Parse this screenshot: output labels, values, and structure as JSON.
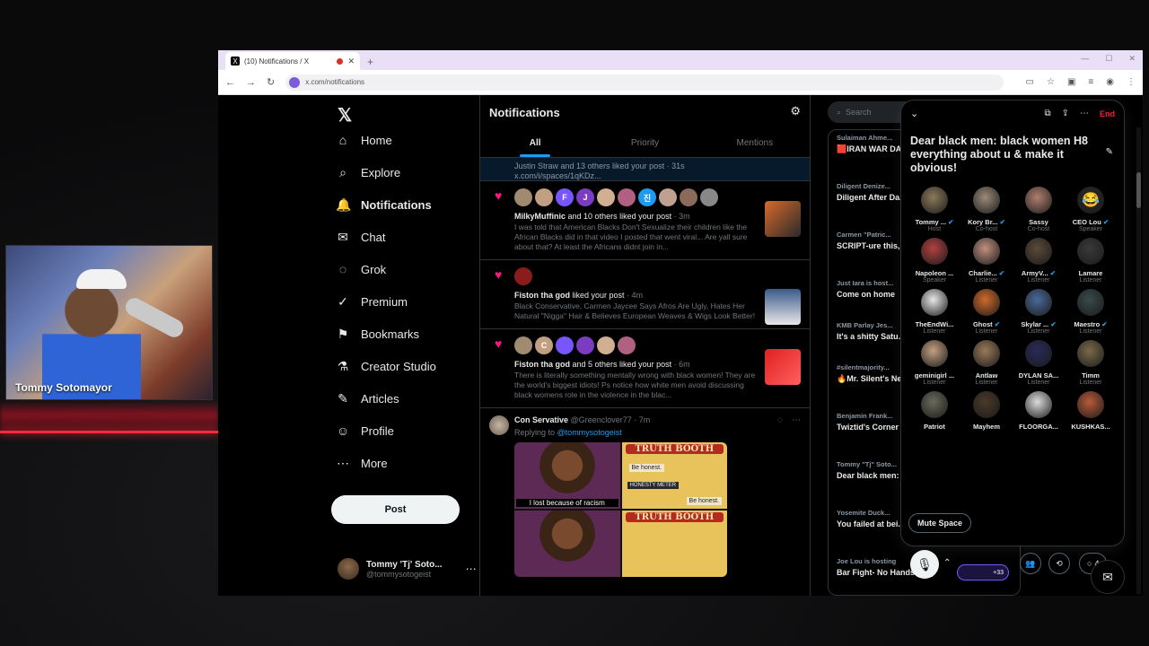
{
  "webcam": {
    "name_tag": "Tommy Sotomayor"
  },
  "browser": {
    "tab_title": "(10) Notifications / X",
    "url": "x.com/notifications"
  },
  "nav": {
    "items": [
      {
        "label": "Home",
        "icon": "home-icon",
        "glyph": "⌂"
      },
      {
        "label": "Explore",
        "icon": "search-icon",
        "glyph": "⌕"
      },
      {
        "label": "Notifications",
        "icon": "bell-icon",
        "glyph": "🔔"
      },
      {
        "label": "Chat",
        "icon": "mail-icon",
        "glyph": "✉"
      },
      {
        "label": "Grok",
        "icon": "grok-icon",
        "glyph": "◌"
      },
      {
        "label": "Premium",
        "icon": "verified-icon",
        "glyph": "✓"
      },
      {
        "label": "Bookmarks",
        "icon": "bookmark-icon",
        "glyph": "⚑"
      },
      {
        "label": "Creator Studio",
        "icon": "flask-icon",
        "glyph": "⚗"
      },
      {
        "label": "Articles",
        "icon": "article-icon",
        "glyph": "✎"
      },
      {
        "label": "Profile",
        "icon": "person-icon",
        "glyph": "☺"
      },
      {
        "label": "More",
        "icon": "more-circle-icon",
        "glyph": "⋯"
      }
    ],
    "post_label": "Post",
    "account": {
      "name": "Tommy 'Tj' Soto...",
      "handle": "@tommysotogeist"
    }
  },
  "feed": {
    "title": "Notifications",
    "tabs": [
      "All",
      "Priority",
      "Mentions"
    ],
    "strip": {
      "line1": "Justin Straw and 13 others liked your post · 31s",
      "line2": "x.com/i/spaces/1qKDz..."
    },
    "items": [
      {
        "who": "MilkyMuffinic",
        "rest": "and 10 others liked your post",
        "time": "· 3m",
        "body": "I was told that American Blacks Don't Sexualize their children like the African Blacks did in that video I posted that went viral... Are yall sure about that? At least the Africans didnt join in...",
        "avatars": [
          "",
          "",
          "F",
          "J",
          "",
          "",
          "진",
          "",
          "",
          ""
        ]
      },
      {
        "who": "Fiston tha god",
        "rest": "liked your post",
        "time": "· 4m",
        "body": "Black Conservative, Carmen Jaycee Says Afros Are Ugly, Hates Her Natural \"Nigga\" Hair & Believes European Weaves & Wigs Look Better!",
        "avatars": [
          ""
        ]
      },
      {
        "who": "Fiston tha god",
        "rest": "and 5 others liked your post",
        "time": "· 6m",
        "body": "There is literally something mentally wrong with black women! They are the world's biggest idiots! Ps notice how white men avoid discussing black womens role in the violence in the blac...",
        "avatars": [
          "",
          "C",
          "",
          "",
          "",
          ""
        ]
      }
    ],
    "reply": {
      "name": "Con Servative",
      "handle": "@Greenclover77",
      "time": "· 7m",
      "replying_to": "Replying to",
      "mention": "@tommysotogeist",
      "meme": {
        "caption": "I lost because of racism",
        "booth": "TRUTH BOOTH",
        "sign1": "Be honest.",
        "sign2": "Be honest.",
        "meter": "HONESTY METER"
      }
    }
  },
  "right": {
    "search_placeholder": "Search",
    "live": [
      {
        "host": "Sulaiman Ahme...",
        "title": "🟥IRAN WAR DA... Ryan Dawson"
      },
      {
        "host": "Diligent Denize...",
        "title": "Diligent After Da... Come Complain"
      },
      {
        "host": "Carmen \"Patric...",
        "title": "SCRIPT-ure this, ure that:✨CHOS..."
      },
      {
        "host": "Just Iara is host...",
        "title": "Come on home"
      },
      {
        "host": "KMB Parlay Jes...",
        "title": "It's a shitty Satu..."
      },
      {
        "host": "#silentmajority...",
        "title": "🔥Mr. Silent's Neighborhood🔥"
      },
      {
        "host": "Benjamin Frank...",
        "title": "Twiztid's Corner Well...Well...Well..."
      },
      {
        "host": "Tommy \"Tj\" Soto...",
        "title": "Dear black men: women H8 every..."
      },
      {
        "host": "Yosemite Duck...",
        "title": "You failed at bei... twitter space host?"
      },
      {
        "host": "Joe Lou is hosting",
        "title": "Bar Fight- No Hands Only"
      }
    ],
    "pill_count": "+33"
  },
  "space": {
    "end_label": "End",
    "title": "Dear black men: black women H8 everything about u & make it obvious!",
    "participants": [
      {
        "name": "Tommy ...",
        "role": "Host",
        "glyph": "",
        "color": "#8a7a5a",
        "verified": true
      },
      {
        "name": "Kory Br...",
        "role": "Co-host",
        "glyph": "",
        "color": "#9a8a7a",
        "verified": true
      },
      {
        "name": "Sassy",
        "role": "Co-host",
        "glyph": "",
        "color": "#b08070",
        "verified": false
      },
      {
        "name": "CEO Lou",
        "role": "Speaker",
        "glyph": "😂",
        "color": "#2a2a2a",
        "verified": true
      },
      {
        "name": "Napoleon ...",
        "role": "Speaker",
        "glyph": "",
        "color": "#b24040",
        "verified": false
      },
      {
        "name": "Charlie...",
        "role": "Listener",
        "glyph": "",
        "color": "#c09080",
        "verified": true
      },
      {
        "name": "ArmyV...",
        "role": "Listener",
        "glyph": "",
        "color": "#5a4a3a",
        "verified": true
      },
      {
        "name": "Lamare",
        "role": "Listener",
        "glyph": "",
        "color": "#3a3a3a",
        "verified": false
      },
      {
        "name": "TheEndWi...",
        "role": "Listener",
        "glyph": "",
        "color": "#e8e8e8",
        "verified": false
      },
      {
        "name": "Ghost",
        "role": "Listener",
        "glyph": "",
        "color": "#d06a2a",
        "verified": true
      },
      {
        "name": "Skylar ...",
        "role": "Listener",
        "glyph": "",
        "color": "#4a6a9a",
        "verified": true
      },
      {
        "name": "Maestro",
        "role": "Listener",
        "glyph": "",
        "color": "#3a4a4a",
        "verified": true
      },
      {
        "name": "geminigirl ...",
        "role": "Listener",
        "glyph": "",
        "color": "#c4a080",
        "verified": false
      },
      {
        "name": "Antlaw",
        "role": "Listener",
        "glyph": "",
        "color": "#9a7a5a",
        "verified": false
      },
      {
        "name": "DYLAN SA...",
        "role": "Listener",
        "glyph": "",
        "color": "#2a2a5a",
        "verified": false
      },
      {
        "name": "Timm",
        "role": "Listener",
        "glyph": "",
        "color": "#7a6a4a",
        "verified": false
      },
      {
        "name": "Patriot",
        "role": "",
        "glyph": "",
        "color": "#6a6a5a",
        "verified": false
      },
      {
        "name": "Mayhem",
        "role": "",
        "glyph": "",
        "color": "#4a3a2a",
        "verified": false
      },
      {
        "name": "FLOORGA...",
        "role": "",
        "glyph": "",
        "color": "#dcdcdc",
        "verified": false
      },
      {
        "name": "KUSHKAS...",
        "role": "",
        "glyph": "",
        "color": "#b85a3a",
        "verified": false
      }
    ],
    "mute_label": "Mute Space",
    "comment_count": "4"
  }
}
